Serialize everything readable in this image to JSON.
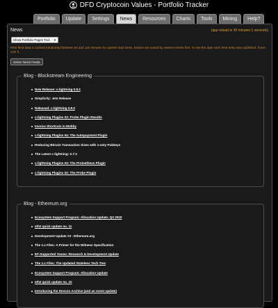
{
  "app": {
    "title": "DFD Cryptocoin Values - Portfolio Tracker",
    "logo_icon": "bitcoin-user-icon"
  },
  "tabs": [
    {
      "label": "Portfolio",
      "active": false
    },
    {
      "label": "Update",
      "active": false
    },
    {
      "label": "Settings",
      "active": false
    },
    {
      "label": "News",
      "active": true
    },
    {
      "label": "Resources",
      "active": false
    },
    {
      "label": "Charts",
      "active": false
    },
    {
      "label": "Tools",
      "active": false
    },
    {
      "label": "Mining",
      "active": false
    },
    {
      "label": "Help?",
      "active": false
    }
  ],
  "news": {
    "panel_title": "News",
    "status_note": "(app reload in 30 minutes 1 seconds)",
    "feed_select": "Show Portfolio Pages Tool",
    "rss_note": "RSS feed data is cached (randomly) between 60 and 120 minutes for quicker load times. Entries are sorted by newest entries first. To see the date each feed entry was published, hover over it.",
    "select_feeds_button": "Select News Feeds"
  },
  "feeds": [
    {
      "title": "Blog - Blockstream Engineering",
      "entries": [
        {
          "text": "New Release: c-lightning 0.8.2",
          "link": true
        },
        {
          "text": "Simplicity: Jets Release",
          "link": false
        },
        {
          "text": "Released: c-lightning 0.8.0",
          "link": true
        },
        {
          "text": "c-lightning Plugins 03: Probe Plugin Results",
          "link": true
        },
        {
          "text": "Invoice Shortcuts in Mobby",
          "link": true
        },
        {
          "text": "c-lightning Plugins 04: The Autopayment Plugin",
          "link": true
        },
        {
          "text": "Reducing Bitcoin Transaction Sizes with x-only Pubkeys",
          "link": false
        },
        {
          "text": "The Latest c-lightning: 0.7.3",
          "link": false
        },
        {
          "text": "c-lightning Plugins 03: The Prometheus Plugin",
          "link": true
        },
        {
          "text": "c-lightning Plugins 02: The Probe Plugin",
          "link": true
        }
      ]
    },
    {
      "title": "Blog - Ethereum.org",
      "entries": [
        {
          "text": "Ecosystem Support Program: Allocation Update: Q3 2020",
          "link": true
        },
        {
          "text": "eth2 quick update no. 11",
          "link": true
        },
        {
          "text": "Development Update #3 - Ethereum.org",
          "link": false
        },
        {
          "text": "The 1.x Files: A Primer for the Witness Specification",
          "link": false
        },
        {
          "text": "EF-Supported Teams: Research & Development Update",
          "link": true
        },
        {
          "text": "The 1.x Files: The Updated Stateless Tech Tree",
          "link": true
        },
        {
          "text": "Ecosystem Support Program: Allocation Update",
          "link": true
        },
        {
          "text": "eth2 quick update no. 10",
          "link": true
        },
        {
          "text": "Introducing the Devcon Archive (and an event update)",
          "link": true
        }
      ]
    }
  ]
}
